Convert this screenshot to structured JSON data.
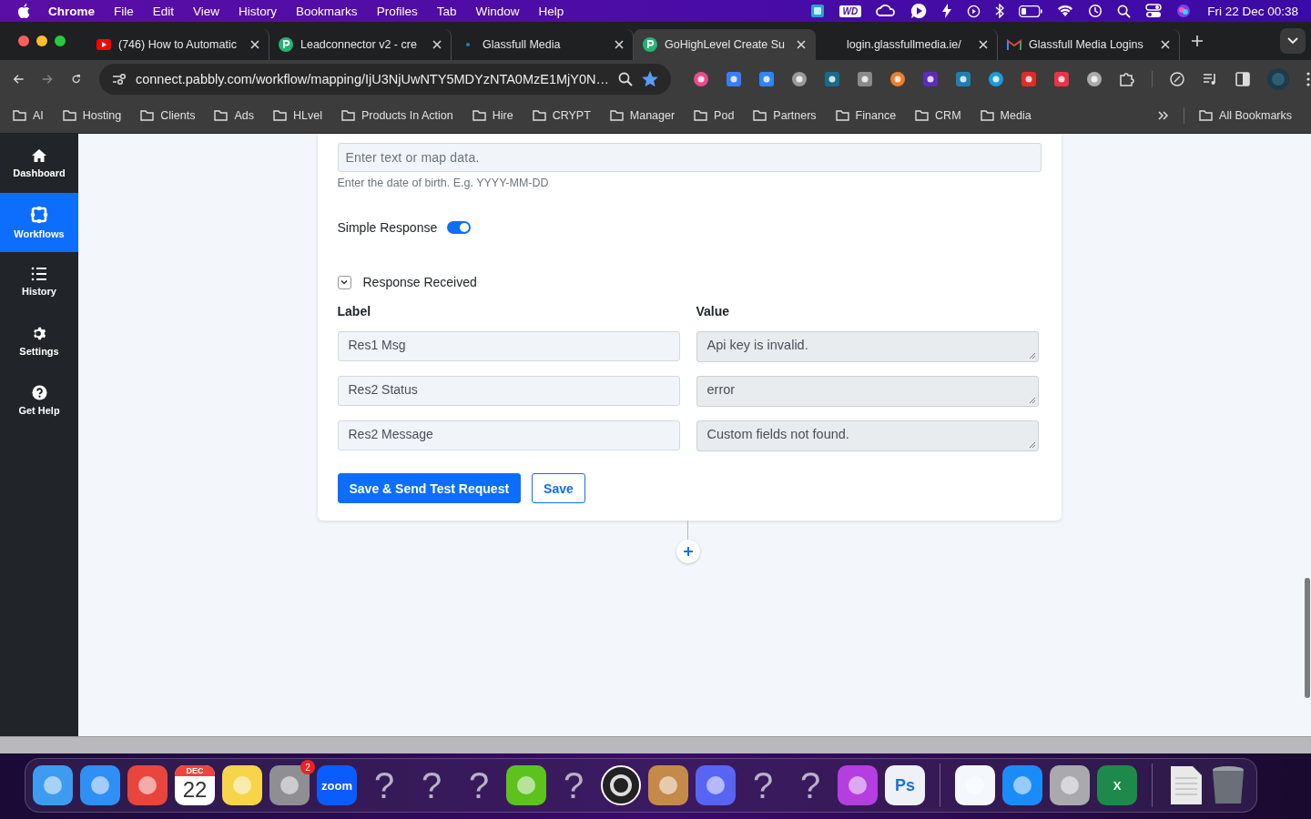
{
  "menubar": {
    "app": "Chrome",
    "menus": [
      "File",
      "Edit",
      "View",
      "History",
      "Bookmarks",
      "Profiles",
      "Tab",
      "Window",
      "Help"
    ],
    "status_icons": [
      {
        "kind": "tile"
      },
      {
        "kind": "label",
        "text": "WD"
      },
      {
        "kind": "cloud"
      },
      {
        "kind": "play-bubble"
      },
      {
        "kind": "bolt"
      },
      {
        "kind": "play"
      },
      {
        "kind": "bluetooth"
      },
      {
        "kind": "battery"
      },
      {
        "kind": "wifi"
      },
      {
        "kind": "clock"
      },
      {
        "kind": "search"
      },
      {
        "kind": "switches"
      },
      {
        "kind": "siri"
      }
    ],
    "clock": "Fri 22 Dec  00:38"
  },
  "tabs": [
    {
      "title": "(746) How to Automatic",
      "kind": "video",
      "selected": false
    },
    {
      "title": "Leadconnector v2 - cre",
      "kind": "flow",
      "selected": false
    },
    {
      "title": "Glassfull Media",
      "kind": "site",
      "selected": false
    },
    {
      "title": "GoHighLevel Create Su",
      "kind": "flow",
      "selected": true
    },
    {
      "title": "login.glassfullmedia.ie/",
      "kind": "blank",
      "selected": false
    },
    {
      "title": "Glassfull Media Logins",
      "kind": "mail",
      "selected": false
    }
  ],
  "address": {
    "url": "connect.pabbly.com/workflow/mapping/IjU3NjUwNTY5MDYzNTA0MzE1MjY0N…",
    "starred": true
  },
  "bookmarks": [
    "AI",
    "Hosting",
    "Clients",
    "Ads",
    "HLvel",
    "Products In Action",
    "Hire",
    "CRYPT",
    "Manager",
    "Pod",
    "Partners",
    "Finance",
    "CRM",
    "Media"
  ],
  "all_bookmarks": "All Bookmarks",
  "sidebar": [
    {
      "label": "Dashboard",
      "kind": "home",
      "selected": false
    },
    {
      "label": "Workflows",
      "kind": "workflow",
      "selected": true
    },
    {
      "label": "History",
      "kind": "list",
      "selected": false
    },
    {
      "label": "Settings",
      "kind": "gear",
      "selected": false
    },
    {
      "label": "Get Help",
      "kind": "help",
      "selected": false
    }
  ],
  "form": {
    "placeholder": "Enter text or map data.",
    "help": "Enter the date of birth. E.g. YYYY-MM-DD",
    "simple_response": {
      "label": "Simple Response",
      "on": true
    },
    "response_received": {
      "label": "Response Received",
      "expanded": true
    },
    "columns": [
      "Label",
      "Value"
    ],
    "rows": [
      {
        "label": "Res1 Msg",
        "value": "Api key is invalid."
      },
      {
        "label": "Res2 Status",
        "value": "error"
      },
      {
        "label": "Res2 Message",
        "value": "Custom fields not found."
      }
    ],
    "primary_button": "Save & Send Test Request",
    "secondary_button": "Save"
  },
  "dock": [
    {
      "kind": "tile",
      "color": "#3d9cf0"
    },
    {
      "kind": "tile",
      "color": "#2f8ff5"
    },
    {
      "kind": "tile",
      "color": "#e8453c"
    },
    {
      "kind": "calendar",
      "month": "DEC",
      "day": "22",
      "color": "#f0443a"
    },
    {
      "kind": "tile",
      "color": "#f7d54a"
    },
    {
      "kind": "tile",
      "color": "#8e8e93",
      "badge": "2"
    },
    {
      "kind": "text",
      "text": "zoom",
      "color": "#0b5cff"
    },
    {
      "kind": "missing",
      "text": "?"
    },
    {
      "kind": "missing",
      "text": "?"
    },
    {
      "kind": "missing",
      "text": "?"
    },
    {
      "kind": "tile",
      "color": "#5dc21e"
    },
    {
      "kind": "missing",
      "text": "?"
    },
    {
      "kind": "round",
      "color": "#222222"
    },
    {
      "kind": "tile",
      "color": "#c58a4a"
    },
    {
      "kind": "tile",
      "color": "#5865f2"
    },
    {
      "kind": "missing",
      "text": "?"
    },
    {
      "kind": "missing",
      "text": "?"
    },
    {
      "kind": "tile",
      "color": "#b43ee0"
    },
    {
      "kind": "light-text",
      "text": "Ps",
      "color": "#eef1f6"
    },
    {
      "kind": "separator"
    },
    {
      "kind": "tile",
      "color": "#f4f7fb"
    },
    {
      "kind": "tile",
      "color": "#1a8cf7"
    },
    {
      "kind": "tile",
      "color": "#a9a9ae"
    },
    {
      "kind": "text",
      "text": "X",
      "color": "#1d8a4b"
    },
    {
      "kind": "separator"
    },
    {
      "kind": "document",
      "color": "#e9e9e9"
    },
    {
      "kind": "trash",
      "color": "#6a6f78"
    }
  ]
}
